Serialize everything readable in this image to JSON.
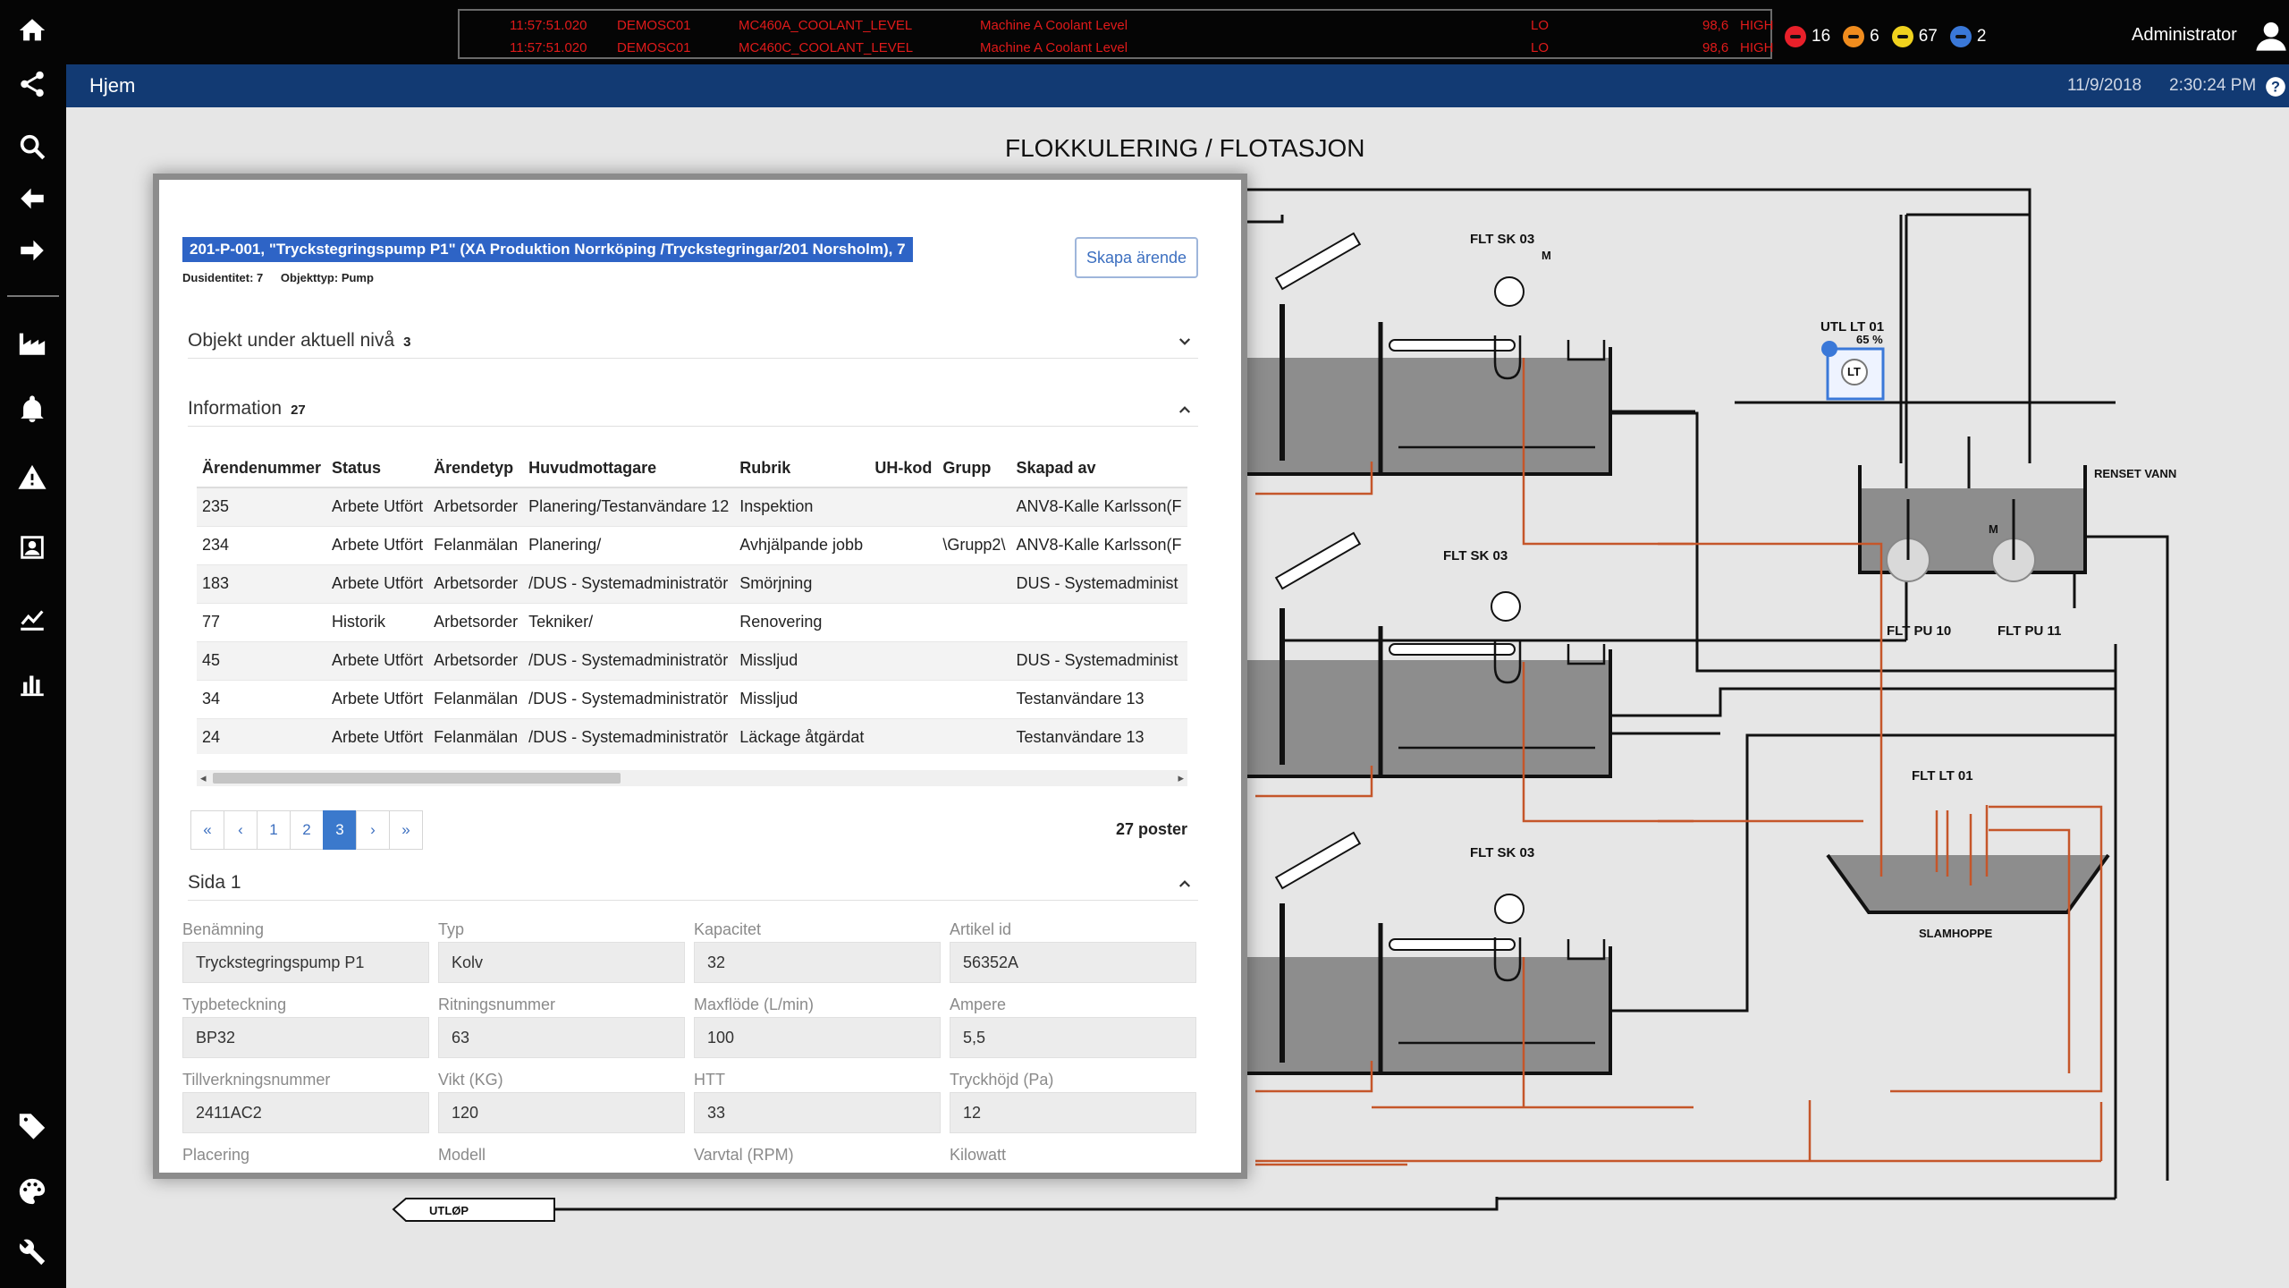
{
  "alarm_banner": {
    "rows": [
      {
        "time": "11:57:51.020",
        "node": "DEMOSC01",
        "tag": "MC460A_COOLANT_LEVEL",
        "description": "Machine A Coolant Level",
        "state": "LO",
        "value": "98,6",
        "limit": "HIGH"
      },
      {
        "time": "11:57:51.020",
        "node": "DEMOSC01",
        "tag": "MC460C_COOLANT_LEVEL",
        "description": "Machine A Coolant Level",
        "state": "LO",
        "value": "98,6",
        "limit": "HIGH"
      }
    ],
    "text_color": "#e01a1a"
  },
  "alarm_counts": [
    {
      "count": "16",
      "color": "#e8202a",
      "icon": "critical-alarm-icon"
    },
    {
      "count": "6",
      "color": "#f08c1e",
      "icon": "high-alarm-icon"
    },
    {
      "count": "67",
      "color": "#f0d21e",
      "icon": "medium-alarm-icon"
    },
    {
      "count": "2",
      "color": "#3a78d8",
      "icon": "low-alarm-icon"
    }
  ],
  "user": {
    "name": "Administrator"
  },
  "nav": {
    "title": "Hjem",
    "date": "11/9/2018",
    "time": "2:30:24 PM"
  },
  "sidebar_icons": [
    "home-icon",
    "share-icon",
    "search-icon",
    "back-arrow-icon",
    "forward-arrow-icon",
    "factory-icon",
    "bell-icon",
    "warning-icon",
    "contacts-icon",
    "trend-icon",
    "bar-chart-icon",
    "tag-icon",
    "palette-icon",
    "wrench-icon"
  ],
  "diagram": {
    "title": "FLOKKULERING / FLOTASJON",
    "labels": {
      "tank1": "FLT SK 03",
      "tank2": "FLT SK 03",
      "tank3": "FLT SK 03",
      "level_tx": "UTL LT 01",
      "level_pct": "65 %",
      "level_symbol": "LT",
      "motor": "M",
      "clean_water": "RENSET VANN",
      "pump1": "FLT PU 10",
      "pump2": "FLT PU 11",
      "sludge_lt": "FLT LT 01",
      "sludge_hopper": "SLAMHOPPE",
      "outlet": "UTLØP"
    }
  },
  "panel": {
    "title": "201-P-001, \"Tryckstegringspump P1\" (XA Produktion Norrköping /Tryckstegringar/201 Norsholm), 7",
    "meta": {
      "entity": "Dusidentitet: 7",
      "object_type": "Objekttyp: Pump"
    },
    "create_button": "Skapa ärende",
    "sections": {
      "objects": {
        "label": "Objekt under aktuell nivå",
        "count": "3"
      },
      "information": {
        "label": "Information",
        "count": "27"
      },
      "page": {
        "label": "Sida 1"
      }
    },
    "table": {
      "headers": [
        "Ärendenummer",
        "Status",
        "Ärendetyp",
        "Huvudmottagare",
        "Rubrik",
        "UH-kod",
        "Grupp",
        "Skapad av"
      ],
      "rows": [
        [
          "235",
          "Arbete Utfört",
          "Arbetsorder",
          "Planering/Testanvändare 12",
          "Inspektion",
          "",
          "",
          "ANV8-Kalle Karlsson(F"
        ],
        [
          "234",
          "Arbete Utfört",
          "Felanmälan",
          "Planering/",
          "Avhjälpande jobb",
          "",
          "\\Grupp2\\",
          "ANV8-Kalle Karlsson(F"
        ],
        [
          "183",
          "Arbete Utfört",
          "Arbetsorder",
          "/DUS - Systemadministratör",
          "Smörjning",
          "",
          "",
          "DUS - Systemadminist"
        ],
        [
          "77",
          "Historik",
          "Arbetsorder",
          "Tekniker/",
          "Renovering",
          "",
          "",
          ""
        ],
        [
          "45",
          "Arbete Utfört",
          "Arbetsorder",
          "/DUS - Systemadministratör",
          "Misslјud",
          "",
          "",
          "DUS - Systemadminist"
        ],
        [
          "34",
          "Arbete Utfört",
          "Felanmälan",
          "/DUS - Systemadministratör",
          "Missljud",
          "",
          "",
          "Testanvändare 13"
        ],
        [
          "24",
          "Arbete Utfört",
          "Felanmälan",
          "/DUS - Systemadministratör",
          "Läckage åtgärdat",
          "",
          "",
          "Testanvändare 13"
        ]
      ]
    },
    "pager": {
      "first": "«",
      "prev": "‹",
      "pages": [
        "1",
        "2",
        "3"
      ],
      "active": "3",
      "next": "›",
      "last": "»",
      "records": "27 poster"
    },
    "form": [
      {
        "label": "Benämning",
        "value": "Tryckstegringspump P1"
      },
      {
        "label": "Typ",
        "value": "Kolv"
      },
      {
        "label": "Kapacitet",
        "value": "32"
      },
      {
        "label": "Artikel id",
        "value": "56352A"
      },
      {
        "label": "Typbeteckning",
        "value": "BP32"
      },
      {
        "label": "Ritningsnummer",
        "value": "63"
      },
      {
        "label": "Maxflöde (L/min)",
        "value": "100"
      },
      {
        "label": "Ampere",
        "value": "5,5"
      },
      {
        "label": "Tillverkningsnummer",
        "value": "2411AC2"
      },
      {
        "label": "Vikt (KG)",
        "value": "120"
      },
      {
        "label": "HTT",
        "value": "33"
      },
      {
        "label": "Tryckhöjd (Pa)",
        "value": "12"
      },
      {
        "label": "Placering",
        "value": ""
      },
      {
        "label": "Modell",
        "value": ""
      },
      {
        "label": "Varvtal (RPM)",
        "value": ""
      },
      {
        "label": "Kilowatt",
        "value": ""
      }
    ]
  }
}
